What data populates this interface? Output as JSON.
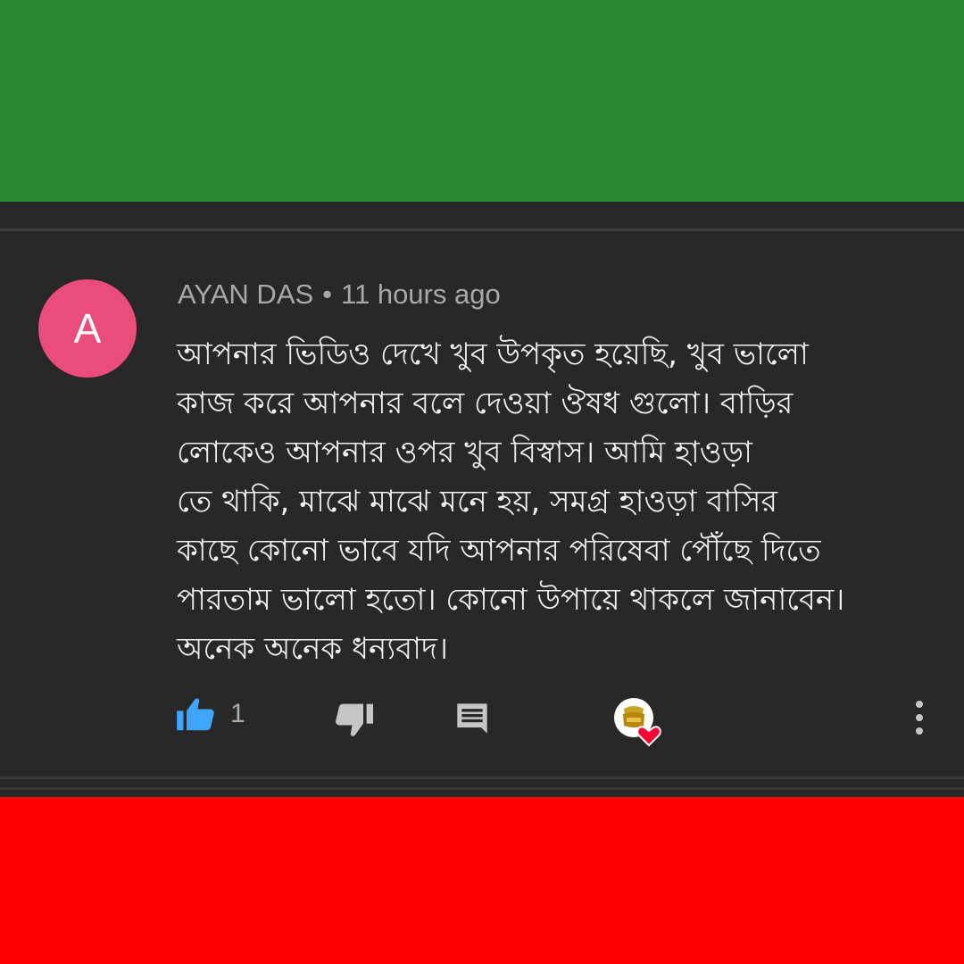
{
  "comment": {
    "avatar_letter": "A",
    "author": "AYAN DAS",
    "separator": "•",
    "time": "11 hours ago",
    "text": "আপনার ভিডিও দেখে খুব উপকৃত হয়েছি, খুব ভালো\nকাজ করে আপনার বলে দেওয়া ঔষধ গুলো। বাড়ির\nলোকেও আপনার ওপর খুব বিস্বাস। আমি হাওড়া\nতে থাকি, মাঝে মাঝে মনে হয়, সমগ্র হাওড়া বাসির\nকাছে  কোনো ভাবে যদি আপনার পরিষেবা পৌঁছে দিতে\nপারতাম ভালো হতো। কোনো উপায়ে থাকলে জানাবেন।\nঅনেক অনেক ধন্যবাদ।",
    "like_count": "1"
  },
  "icons": {
    "like": "thumbs-up-icon",
    "dislike": "thumbs-down-icon",
    "reply": "comment-icon",
    "creator_heart": "creator-heart-icon",
    "more": "more-vert-icon"
  },
  "colors": {
    "top_band": "#2a8a33",
    "bottom_band": "#ff0000",
    "background": "#282828",
    "avatar": "#ea4c7b",
    "like_active": "#3ea6ff",
    "heart": "#ff0033"
  }
}
